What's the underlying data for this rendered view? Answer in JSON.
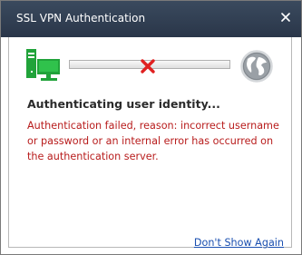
{
  "window": {
    "title": "SSL VPN Authentication"
  },
  "icons": {
    "close": "close-icon",
    "client": "computer-icon",
    "status": "red-x-icon",
    "server": "globe-icon"
  },
  "status": {
    "heading": "Authenticating user identity...",
    "error": "Authentication failed, reason: incorrect username or password or an internal error has occurred on the authentication server."
  },
  "footer": {
    "link_label": "Don't Show Again"
  },
  "colors": {
    "titlebar": "#2f3d50",
    "error_text": "#b81c1c",
    "link": "#1a4fb0",
    "computer_green": "#21a33a",
    "fail_red": "#e02020"
  }
}
